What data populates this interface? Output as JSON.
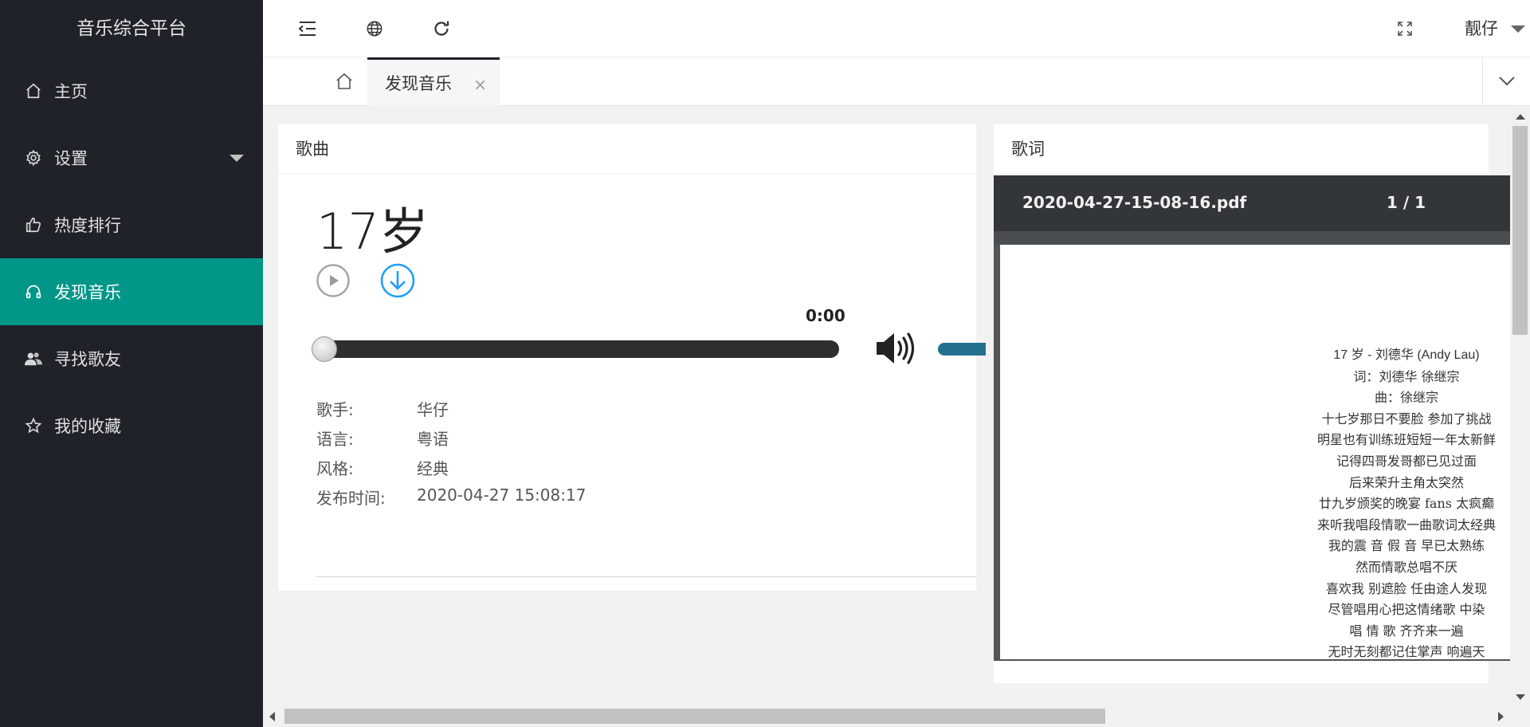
{
  "app": {
    "title": "音乐综合平台"
  },
  "sidebar": {
    "items": [
      {
        "label": "主页",
        "icon": "home-icon"
      },
      {
        "label": "设置",
        "icon": "gear-icon"
      },
      {
        "label": "热度排行",
        "icon": "thumbs-up-icon"
      },
      {
        "label": "发现音乐",
        "icon": "headphones-icon",
        "active": true
      },
      {
        "label": "寻找歌友",
        "icon": "users-icon"
      },
      {
        "label": "我的收藏",
        "icon": "star-icon"
      }
    ]
  },
  "header": {
    "user_name": "靓仔",
    "icons": [
      "menu-collapse-icon",
      "globe-icon",
      "refresh-icon",
      "fullscreen-icon"
    ]
  },
  "tabs": {
    "home_icon": "home-icon",
    "active_label": "发现音乐",
    "close_glyph": "×"
  },
  "song_card": {
    "title": "歌曲",
    "song_name": "17岁",
    "current_time": "0:00",
    "progress": 0,
    "info": [
      {
        "label": "歌手:",
        "value": "华仔"
      },
      {
        "label": "语言:",
        "value": "粤语"
      },
      {
        "label": "风格:",
        "value": "经典"
      },
      {
        "label": "发布时间:",
        "value": "2020-04-27 15:08:17"
      }
    ]
  },
  "lyrics_card": {
    "title": "歌词",
    "pdf_file_name": "2020-04-27-15-08-16.pdf",
    "pdf_page_indicator": "1 / 1",
    "lines": [
      "17 岁 - 刘德华 (Andy Lau)",
      "词：刘德华 徐继宗",
      "曲：徐继宗",
      "十七岁那日不要脸 参加了挑战",
      "明星也有训练班短短一年太新鲜",
      "记得四哥发哥都已见过面",
      "后来荣升主角太突然",
      "廿九岁颁奖的晚宴 fans 太疯癫",
      "来听我唱段情歌一曲歌词太经典",
      "我的震 音 假 音 早已太熟练",
      "然而情歌总唱不厌",
      "喜欢我 别遮脸 任由途人发现",
      "尽管唱用心把这情绪歌 中染",
      "唱 情 歌 齐齐来一遍",
      "无时无刻都记住掌声 响遍天"
    ]
  },
  "colors": {
    "sidebar_bg": "#20222a",
    "accent": "#009688",
    "download_blue": "#1e9fff",
    "volume_bar": "#24718f",
    "pdf_toolbar": "#323639"
  }
}
